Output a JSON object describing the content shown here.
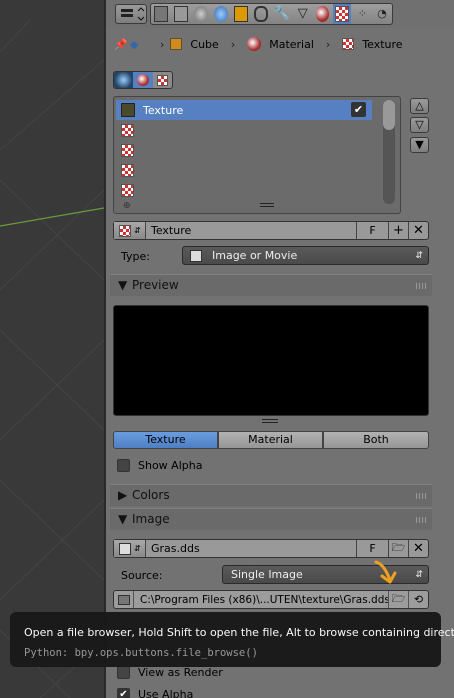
{
  "header": {
    "editor_type": "properties-editor",
    "tabs": [
      "render",
      "render-layers",
      "scene",
      "world",
      "object",
      "constraints",
      "modifiers",
      "data",
      "material",
      "texture",
      "particles",
      "physics"
    ]
  },
  "breadcrumb": {
    "object": "Cube",
    "material": "Material",
    "texture": "Texture"
  },
  "texture_list": {
    "items": [
      {
        "label": "Texture",
        "selected": true
      },
      {
        "label": ""
      },
      {
        "label": ""
      },
      {
        "label": ""
      },
      {
        "label": ""
      }
    ]
  },
  "datablock": {
    "name": "Texture",
    "fake_user": "F"
  },
  "type": {
    "label": "Type:",
    "value": "Image or Movie"
  },
  "preview": {
    "title": "Preview",
    "tabs": [
      "Texture",
      "Material",
      "Both"
    ],
    "active_tab": "Texture",
    "show_alpha": "Show Alpha"
  },
  "colors": {
    "title": "Colors"
  },
  "image": {
    "title": "Image",
    "name": "Gras.dds",
    "fake_user": "F",
    "source_label": "Source:",
    "source_value": "Single Image",
    "path": "C:\\Program Files (x86)\\...UTEN\\texture\\Gras.dds"
  },
  "behind": {
    "view_as_render": "View as Render",
    "use_alpha": "Use Alpha"
  },
  "tooltip": {
    "text": "Open a file browser, Hold Shift to open the file, Alt to browse containing directory.",
    "python": "Python: bpy.ops.buttons.file_browse()"
  },
  "colors_theme": {
    "accent": "#5680c2",
    "arrow": "#f0a020"
  }
}
